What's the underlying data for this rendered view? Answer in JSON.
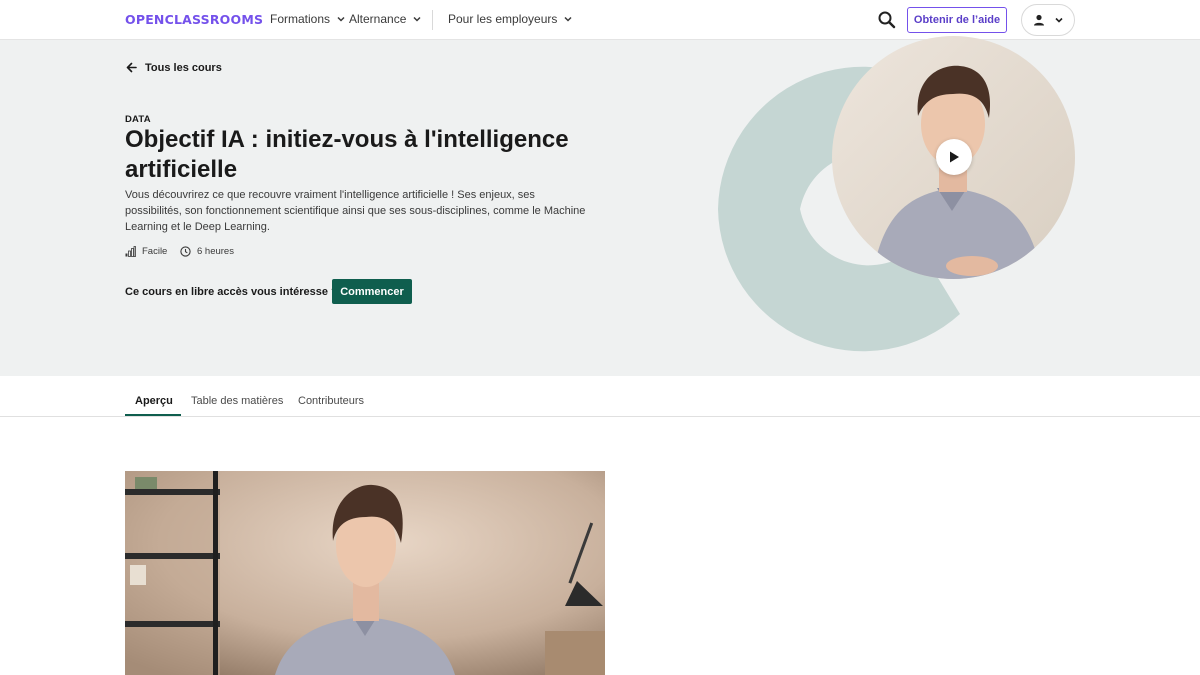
{
  "nav": {
    "logo": "OPENCLASSROOMS",
    "items": [
      {
        "label": "Formations"
      },
      {
        "label": "Alternance"
      },
      {
        "label": "Pour les employeurs"
      }
    ],
    "help_label": "Obtenir de l’aide",
    "icons": {
      "search": "search-icon",
      "user": "user-icon",
      "chevron": "chevron-down-icon"
    }
  },
  "hero": {
    "back_label": "Tous les cours",
    "category": "DATA",
    "title": "Objectif IA : initiez-vous à l'intelligence artificielle",
    "description": "Vous découvrirez ce que recouvre vraiment l'intelligence artificielle ! Ses enjeux, ses possibilités, son fonctionnement scientifique ainsi que ses sous-disciplines, comme le Machine Learning et le Deep Learning.",
    "difficulty": "Facile",
    "duration": "6 heures",
    "cta_text": "Ce cours en libre accès vous intéresse ?",
    "start_label": "Commencer"
  },
  "tabs": [
    {
      "label": "Aperçu",
      "active": true
    },
    {
      "label": "Table des matières",
      "active": false
    },
    {
      "label": "Contributeurs",
      "active": false
    }
  ],
  "colors": {
    "brand": "#7451eb",
    "accent": "#0f5e4e",
    "hero_bg": "#eff1f1",
    "deco": "#c5d6d3"
  }
}
